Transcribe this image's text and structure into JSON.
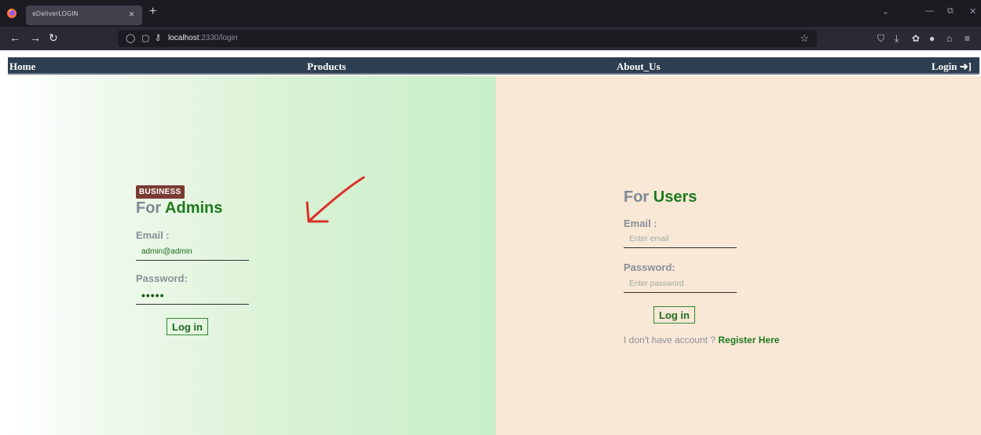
{
  "browser": {
    "tab_title": "eDeliverLOGIN",
    "tab_close": "×",
    "new_tab": "+",
    "url_host": "localhost",
    "url_rest": ":2330/login",
    "win_minimize": "—",
    "win_restore": "⧉",
    "win_close": "✕",
    "list_tabs": "⌄"
  },
  "site_nav": {
    "home": "Home",
    "products": "Products",
    "about": "About_Us",
    "login": "Login"
  },
  "admin": {
    "badge": "BUSINESS",
    "title_prefix": "For ",
    "title_highlight": "Admins",
    "email_label": "Email :",
    "email_value": "admin@admin",
    "password_label": "Password:",
    "password_value": "•••••",
    "login_button": "Log in"
  },
  "user": {
    "title_prefix": "For ",
    "title_highlight": "Users",
    "email_label": "Email :",
    "email_placeholder": "Enter email",
    "password_label": "Password:",
    "password_placeholder": "Enter password",
    "login_button": "Log in",
    "register_prompt": "I don't have account ? ",
    "register_link": "Register Here"
  },
  "colors": {
    "site_nav_bg": "#2c3e50",
    "accent_green": "#1e7a1e",
    "badge_bg": "#7a3b33",
    "user_panel_bg": "#f9e8d6",
    "admin_panel_gradient_end": "#c8efc8",
    "annotation_arrow": "#d9302a"
  }
}
